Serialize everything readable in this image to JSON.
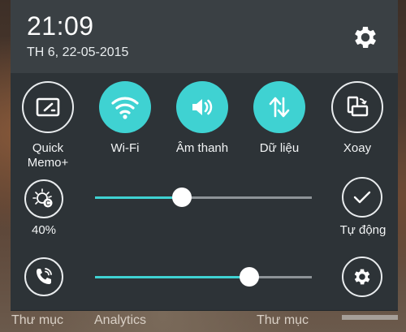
{
  "status": {
    "time": "21:09",
    "date": "TH 6, 22-05-2015"
  },
  "quick_settings": [
    {
      "id": "quickmemo",
      "label_line1": "Quick",
      "label_line2": "Memo+",
      "state": "off",
      "icon": "quickmemo-icon"
    },
    {
      "id": "wifi",
      "label_line1": "Wi-Fi",
      "label_line2": "",
      "state": "on",
      "icon": "wifi-icon"
    },
    {
      "id": "sound",
      "label_line1": "Âm thanh",
      "label_line2": "",
      "state": "on",
      "icon": "speaker-icon"
    },
    {
      "id": "data",
      "label_line1": "Dữ liệu",
      "label_line2": "",
      "state": "on",
      "icon": "data-arrows-icon"
    },
    {
      "id": "rotate",
      "label_line1": "Xoay",
      "label_line2": "",
      "state": "off",
      "icon": "rotate-icon"
    }
  ],
  "brightness": {
    "percent_label": "40%",
    "level": 0.4,
    "auto_label": "Tự động"
  },
  "volume": {
    "level": 0.71
  },
  "background": {
    "left_label": "Thư mục",
    "middle_label": "Analytics",
    "right_label": "Thư mục"
  },
  "colors": {
    "accent": "#3fd2d2",
    "panel": "#2d3337",
    "header": "#3a4044"
  }
}
